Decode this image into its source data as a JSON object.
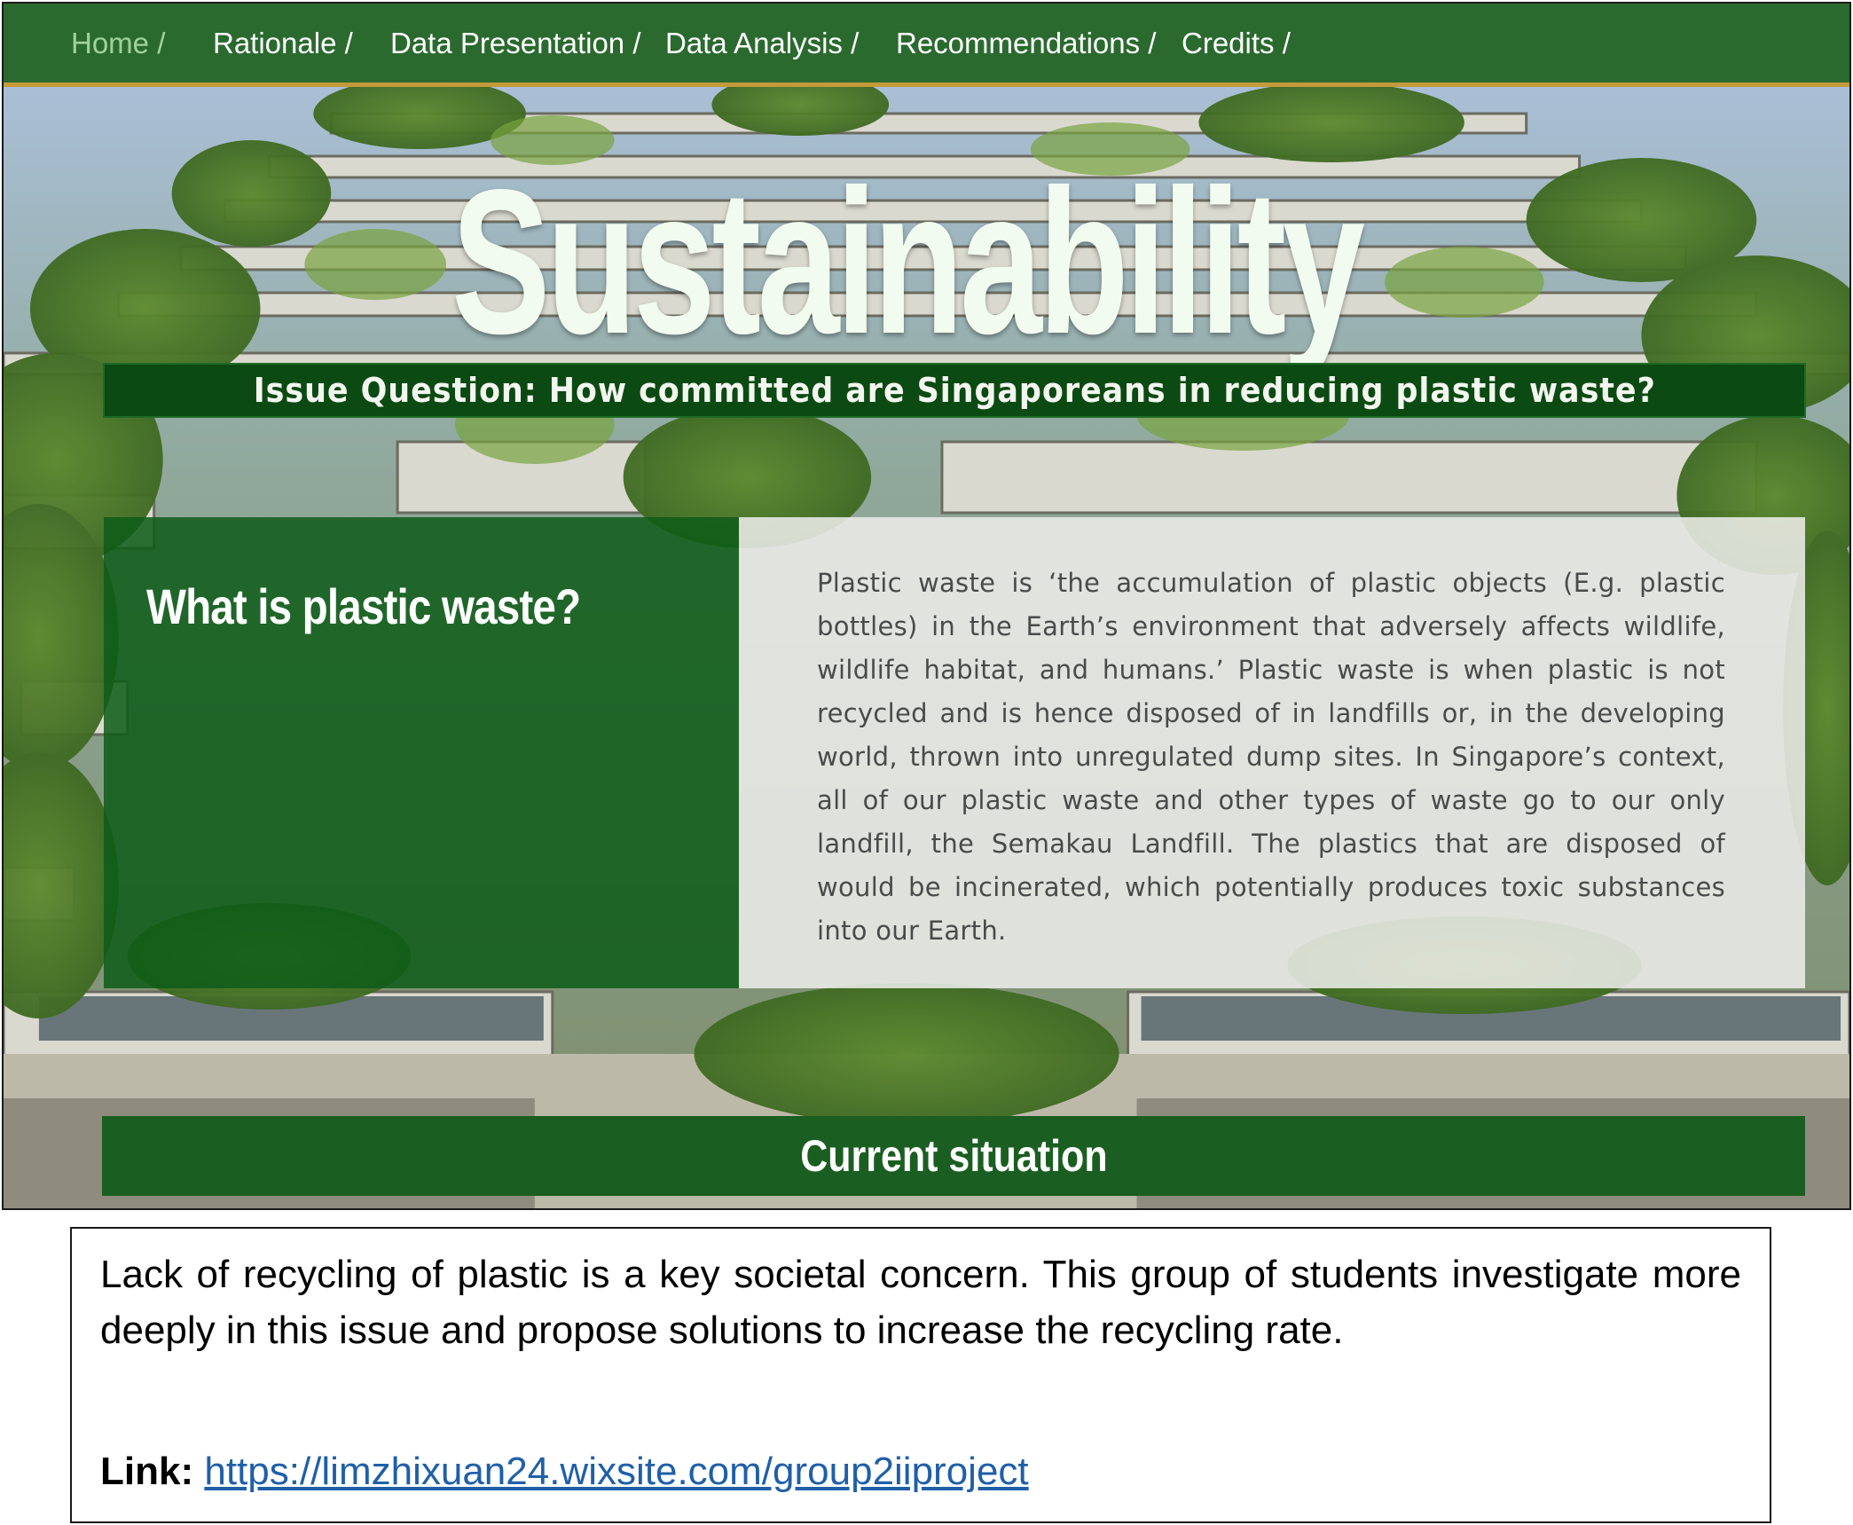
{
  "nav": {
    "items": [
      {
        "label": "Home /",
        "active": true
      },
      {
        "label": "Rationale /",
        "active": false
      },
      {
        "label": "Data Presentation /",
        "active": false
      },
      {
        "label": "Data Analysis /",
        "active": false
      },
      {
        "label": "Recommendations /",
        "active": false
      },
      {
        "label": "Credits /",
        "active": false
      }
    ]
  },
  "hero": {
    "title": "Sustainability",
    "issue_question": "Issue Question: How committed are Singaporeans in reducing plastic waste?",
    "section_heading": "What is plastic waste?",
    "section_body": "Plastic waste is ‘the accumulation of plastic objects (E.g. plastic bottles) in the Earth’s environment that adversely affects wildlife, wildlife habitat, and humans.’ Plastic waste is when plastic is not recycled and is hence disposed of in landfills or, in the developing world, thrown into unregulated dump sites. In Singapore’s context, all of our plastic waste and other types of waste go to our only landfill, the Semakau Landfill. The plastics that are disposed of would be incinerated, which potentially produces toxic substances into our Earth.",
    "current_heading": "Current situation"
  },
  "caption": {
    "text": "Lack of recycling of plastic is a key societal concern. This group of students investigate more deeply in this issue and propose solutions to increase the recycling rate.",
    "link_label": "Link:",
    "link_url": "https://limzhixuan24.wixsite.com/group2iiproject"
  },
  "colors": {
    "nav_bg": "#2b6a2f",
    "nav_active": "#9fd39b",
    "accent_gold": "#c59a3a",
    "panel_green": "#0e5c18",
    "link_blue": "#1f5fa8"
  }
}
